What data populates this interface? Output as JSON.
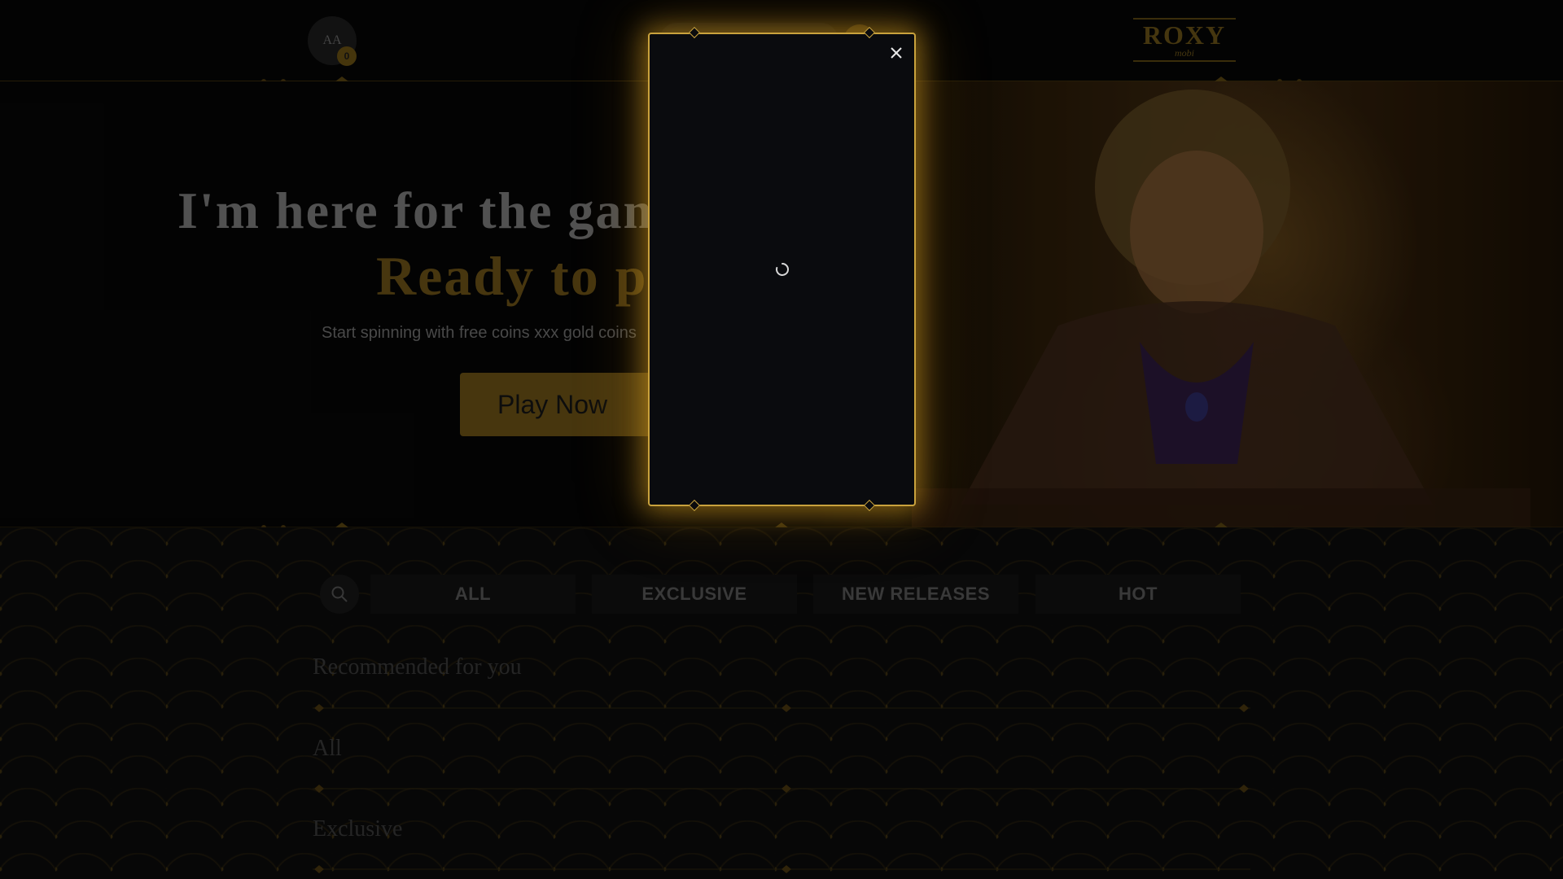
{
  "header": {
    "avatar_initials": "AA",
    "avatar_badge": "0",
    "logo_main": "ROXY",
    "logo_sub": "mobi"
  },
  "hero": {
    "title": "I'm here for the game",
    "subtitle": "Ready to play?",
    "text": "Start spinning with free coins xxx gold coins",
    "play_button": "Play Now"
  },
  "games": {
    "search_icon": "search-icon",
    "tabs": [
      {
        "label": "ALL"
      },
      {
        "label": "EXCLUSIVE"
      },
      {
        "label": "NEW RELEASES"
      },
      {
        "label": "HOT"
      }
    ],
    "sections": [
      {
        "title": "Recommended for you"
      },
      {
        "title": "All"
      },
      {
        "title": "Exclusive"
      }
    ]
  },
  "modal": {
    "close_icon": "close-icon",
    "loading_icon": "spinner-icon",
    "border_color": "#c9a23d"
  },
  "colors": {
    "gold": "#c9a23d",
    "dim_gold": "#6e5416",
    "background": "#060606"
  }
}
